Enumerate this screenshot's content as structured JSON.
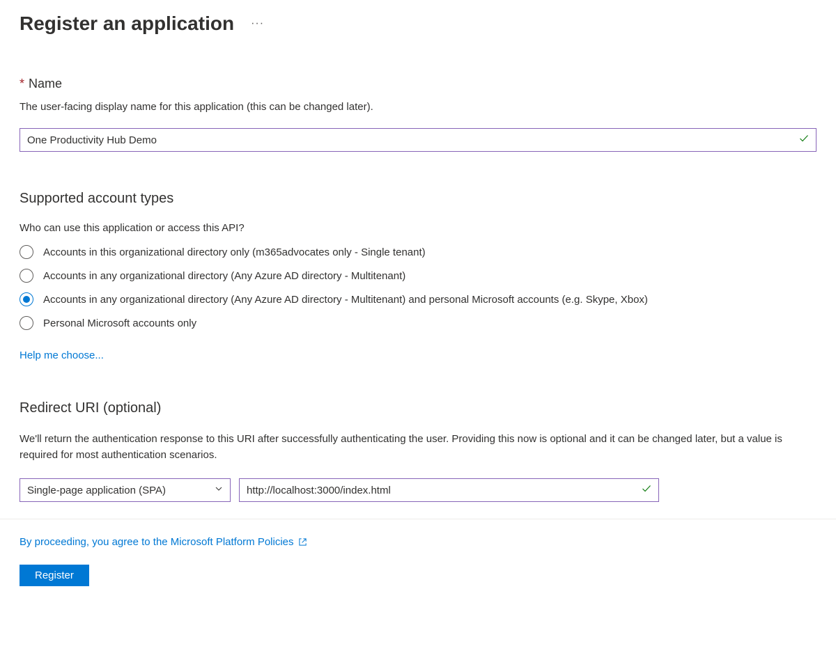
{
  "header": {
    "title": "Register an application"
  },
  "name_section": {
    "label": "Name",
    "description": "The user-facing display name for this application (this can be changed later).",
    "value": "One Productivity Hub Demo"
  },
  "account_types": {
    "heading": "Supported account types",
    "question": "Who can use this application or access this API?",
    "options": [
      {
        "label": "Accounts in this organizational directory only (m365advocates only - Single tenant)",
        "selected": false
      },
      {
        "label": "Accounts in any organizational directory (Any Azure AD directory - Multitenant)",
        "selected": false
      },
      {
        "label": "Accounts in any organizational directory (Any Azure AD directory - Multitenant) and personal Microsoft accounts (e.g. Skype, Xbox)",
        "selected": true
      },
      {
        "label": "Personal Microsoft accounts only",
        "selected": false
      }
    ],
    "help_link": "Help me choose..."
  },
  "redirect_uri": {
    "heading": "Redirect URI (optional)",
    "description": "We'll return the authentication response to this URI after successfully authenticating the user. Providing this now is optional and it can be changed later, but a value is required for most authentication scenarios.",
    "platform_selected": "Single-page application (SPA)",
    "uri_value": "http://localhost:3000/index.html"
  },
  "footer": {
    "policy_text": "By proceeding, you agree to the Microsoft Platform Policies",
    "register_label": "Register"
  }
}
